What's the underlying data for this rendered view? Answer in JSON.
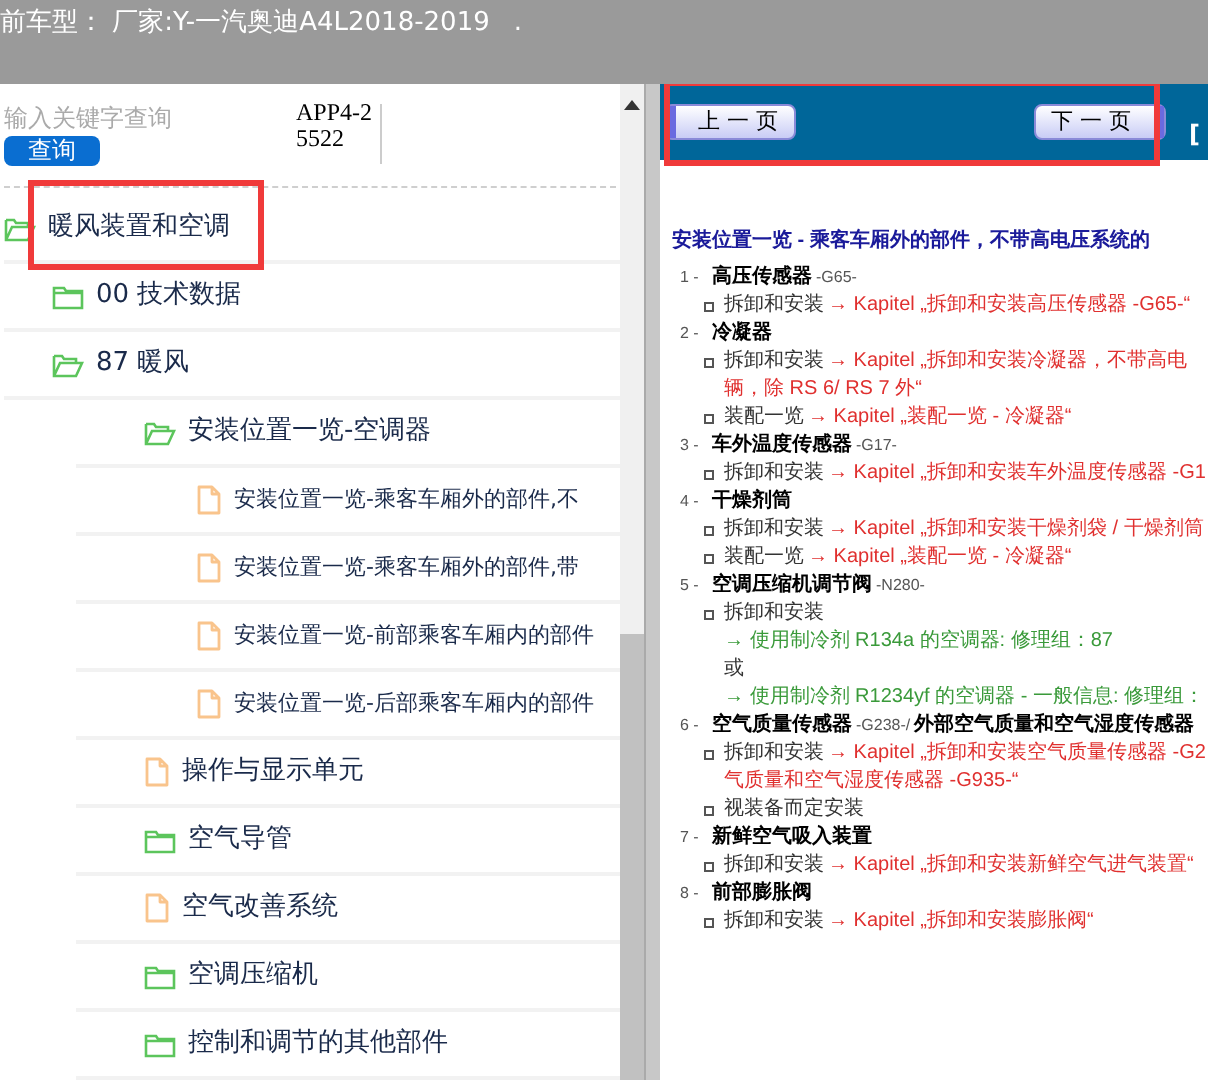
{
  "title_bar": {
    "text": "前车型： 厂家:Y-一汽奥迪A4L2018-2019",
    "suffix": "."
  },
  "search": {
    "placeholder": "输入关键字查询",
    "button": "查询",
    "code": "APP4-25522"
  },
  "tree": [
    {
      "label": "暖风装置和空调",
      "kind": "folder",
      "expanded": true,
      "highlighted": true,
      "children": [
        {
          "label": "00 技术数据",
          "kind": "folder",
          "expanded": false,
          "highlighted": false
        },
        {
          "label": "87 暖风",
          "kind": "folder",
          "expanded": true,
          "children": [
            {
              "label": "安装位置一览-空调器",
              "kind": "folder",
              "expanded": true,
              "children": [
                {
                  "label": "安装位置一览-乘客车厢外的部件,不",
                  "kind": "document",
                  "highlighted": false
                },
                {
                  "label": "安装位置一览-乘客车厢外的部件,带",
                  "kind": "document",
                  "highlighted": false
                },
                {
                  "label": "安装位置一览-前部乘客车厢内的部件",
                  "kind": "document",
                  "highlighted": false
                },
                {
                  "label": "安装位置一览-后部乘客车厢内的部件",
                  "kind": "document",
                  "highlighted": false
                }
              ]
            },
            {
              "label": "操作与显示单元",
              "kind": "document",
              "highlighted": false
            },
            {
              "label": "空气导管",
              "kind": "folder",
              "expanded": false,
              "highlighted": false
            },
            {
              "label": "空气改善系统",
              "kind": "document",
              "highlighted": false
            },
            {
              "label": "空调压缩机",
              "kind": "folder",
              "expanded": false,
              "highlighted": false
            },
            {
              "label": "控制和调节的其他部件",
              "kind": "folder",
              "expanded": false,
              "highlighted": false
            }
          ]
        }
      ]
    }
  ],
  "nav": {
    "prev": "上 一 页",
    "next": "下 一 页",
    "extra": "[",
    "highlighted": true
  },
  "document": {
    "heading": "安装位置一览 - 乘客车厢外的部件，不带高电压系统的",
    "items": [
      {
        "number": "1 -",
        "title": "高压传感器",
        "code": "-G65-",
        "bullets": [
          [
            [
              {
                "kind": "plain",
                "text": "拆卸和安装"
              },
              {
                "kind": "link",
                "text": "→ Kapitel „拆卸和安装高压传感器 -G65-“"
              }
            ]
          ]
        ]
      },
      {
        "number": "2 -",
        "title": "冷凝器",
        "bullets": [
          [
            [
              {
                "kind": "plain",
                "text": "拆卸和安装"
              },
              {
                "kind": "link",
                "text": "→ Kapitel „拆卸和安装冷凝器，不带高电"
              }
            ],
            [
              {
                "kind": "link",
                "text": "辆，除 RS 6/ RS 7 外“"
              }
            ]
          ],
          [
            [
              {
                "kind": "plain",
                "text": "装配一览"
              },
              {
                "kind": "link",
                "text": "→ Kapitel „装配一览 - 冷凝器“"
              }
            ]
          ]
        ]
      },
      {
        "number": "3 -",
        "title": "车外温度传感器",
        "code": "-G17-",
        "bullets": [
          [
            [
              {
                "kind": "plain",
                "text": "拆卸和安装"
              },
              {
                "kind": "link",
                "text": "→ Kapitel „拆卸和安装车外温度传感器 -G1"
              }
            ]
          ]
        ]
      },
      {
        "number": "4 -",
        "title": "干燥剂筒",
        "bullets": [
          [
            [
              {
                "kind": "plain",
                "text": "拆卸和安装"
              },
              {
                "kind": "link",
                "text": "→ Kapitel „拆卸和安装干燥剂袋 / 干燥剂筒"
              }
            ]
          ],
          [
            [
              {
                "kind": "plain",
                "text": "装配一览"
              },
              {
                "kind": "link",
                "text": "→ Kapitel „装配一览 - 冷凝器“"
              }
            ]
          ]
        ]
      },
      {
        "number": "5 -",
        "title": "空调压缩机调节阀",
        "code": "-N280-",
        "bullets": [
          [
            [
              {
                "kind": "plain",
                "text": "拆卸和安装"
              }
            ],
            [
              {
                "kind": "reference",
                "text": "→ 使用制冷剂 R134a 的空调器: 修理组：87"
              }
            ],
            [
              {
                "kind": "plain",
                "text": "或"
              }
            ],
            [
              {
                "kind": "reference",
                "text": "→ 使用制冷剂 R1234yf 的空调器 - 一般信息: 修理组："
              }
            ]
          ]
        ]
      },
      {
        "number": "6 -",
        "title": "空气质量传感器",
        "code": "-G238-/",
        "title2": "外部空气质量和空气湿度传感器",
        "bullets": [
          [
            [
              {
                "kind": "plain",
                "text": "拆卸和安装"
              },
              {
                "kind": "link",
                "text": "→ Kapitel „拆卸和安装空气质量传感器 -G2"
              }
            ],
            [
              {
                "kind": "link",
                "text": "气质量和空气湿度传感器 -G935-“"
              }
            ]
          ],
          [
            [
              {
                "kind": "plain",
                "text": "视装备而定安装"
              }
            ]
          ]
        ]
      },
      {
        "number": "7 -",
        "title": "新鲜空气吸入装置",
        "bullets": [
          [
            [
              {
                "kind": "plain",
                "text": "拆卸和安装"
              },
              {
                "kind": "link",
                "text": "→ Kapitel „拆卸和安装新鲜空气进气装置“"
              }
            ]
          ]
        ]
      },
      {
        "number": "8 -",
        "title": "前部膨胀阀",
        "bullets": [
          [
            [
              {
                "kind": "plain",
                "text": "拆卸和安装"
              },
              {
                "kind": "link",
                "text": "→ Kapitel „拆卸和安装膨胀阀“"
              }
            ]
          ]
        ]
      }
    ]
  }
}
